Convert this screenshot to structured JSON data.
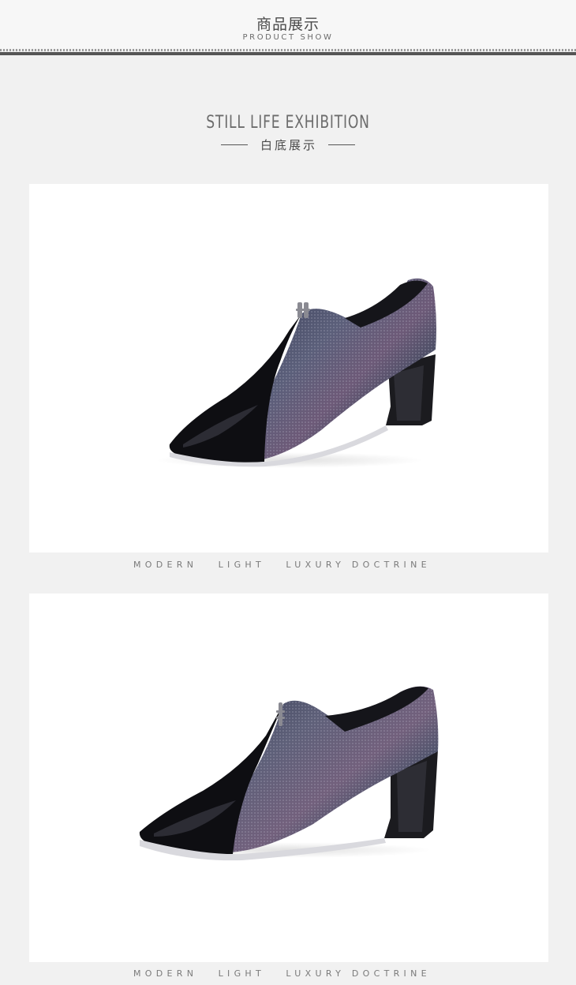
{
  "header": {
    "title": "商品展示",
    "subtitle": "PRODUCT SHOW"
  },
  "section": {
    "title": "STILL LIFE  EXHIBITION",
    "subtitle": "白底展示"
  },
  "gallery": [
    {
      "image_icon": "shoe-image",
      "caption": "MODERN   LIGHT   LUXURY DOCTRINE"
    },
    {
      "image_icon": "shoe-image",
      "caption": "MODERN   LIGHT   LUXURY DOCTRINE"
    }
  ],
  "colors": {
    "background": "#f1f1f1",
    "card": "#ffffff",
    "text_dark": "#4a4a4a",
    "text_muted": "#7a7a7a"
  }
}
